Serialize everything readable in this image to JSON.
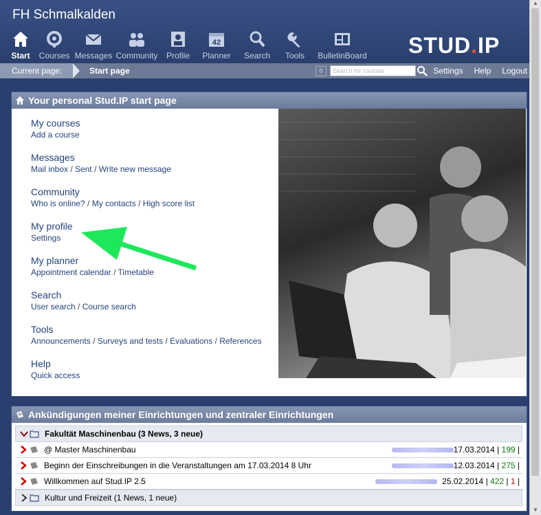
{
  "header": {
    "site_name": "FH Schmalkalden",
    "logo_main": "Stud",
    "logo_dot": ".",
    "logo_end": "IP",
    "nav": [
      {
        "label": "Start",
        "icon": "home-icon",
        "active": true
      },
      {
        "label": "Courses",
        "icon": "courses-icon"
      },
      {
        "label": "Messages",
        "icon": "envelope-icon"
      },
      {
        "label": "Community",
        "icon": "people-icon"
      },
      {
        "label": "Profile",
        "icon": "profile-icon"
      },
      {
        "label": "Planner",
        "icon": "calendar-icon",
        "badge": "42"
      },
      {
        "label": "Search",
        "icon": "magnifier-icon"
      },
      {
        "label": "Tools",
        "icon": "wrench-icon"
      },
      {
        "label": "BulletinBoard",
        "icon": "bulletin-icon"
      }
    ]
  },
  "breadcrumb": {
    "label": "Current page:",
    "current": "Start page",
    "counter": "0",
    "search_placeholder": "Search for courses",
    "links": [
      "Settings",
      "Help",
      "Logout"
    ]
  },
  "start_panel": {
    "title": "Your personal Stud.IP start page",
    "groups": [
      {
        "title": "My courses",
        "subs": [
          "Add a course"
        ]
      },
      {
        "title": "Messages",
        "subs": [
          "Mail inbox",
          "Sent",
          "Write new message"
        ]
      },
      {
        "title": "Community",
        "subs": [
          "Who is online?",
          "My contacts",
          "High score list"
        ]
      },
      {
        "title": "My profile",
        "subs": [
          "Settings"
        ]
      },
      {
        "title": "My planner",
        "subs": [
          "Appointment calendar",
          "Timetable"
        ]
      },
      {
        "title": "Search",
        "subs": [
          "User search",
          "Course search"
        ]
      },
      {
        "title": "Tools",
        "subs": [
          "Announcements",
          "Surveys and tests",
          "Evaluations",
          "References"
        ]
      },
      {
        "title": "Help",
        "subs": [
          "Quick access"
        ]
      }
    ],
    "separator": " / "
  },
  "news_panel": {
    "title": "Ankündigungen meiner Einrichtungen und zentraler Einrichtungen",
    "folder1": "Fakultät Maschinenbau (3 News, 3 neue)",
    "items": [
      {
        "title": "@ Master Maschinenbau",
        "date": "17.03.2014",
        "views": "199",
        "comments": ""
      },
      {
        "title": "Beginn der Einschreibungen in die Veranstaltungen am 17.03.2014 8 Uhr",
        "date": "12.03.2014",
        "views": "275",
        "comments": ""
      },
      {
        "title": "Willkommen auf Stud.IP 2.5",
        "date": "25.02.2014",
        "views": "422",
        "comments": "1"
      }
    ],
    "folder2": "Kultur und Freizeit (1 News, 1 neue)"
  },
  "colors": {
    "brand": "#2a3f6d",
    "link": "#24437c",
    "arrow": "#1ee85a",
    "logo_dot": "#e94f30"
  }
}
